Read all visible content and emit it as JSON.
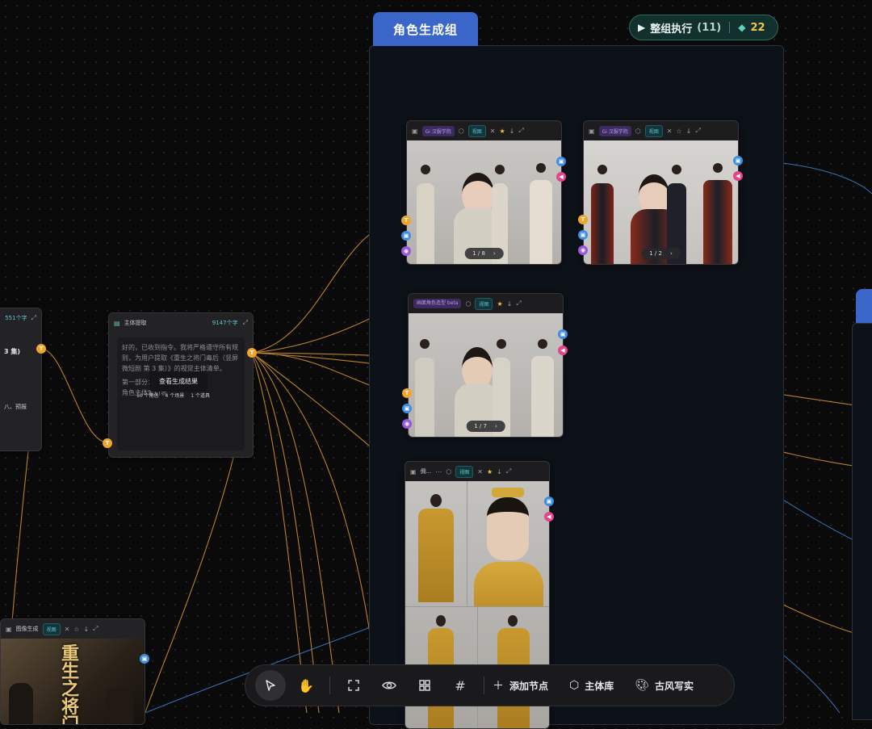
{
  "group": {
    "title": "角色生成组"
  },
  "exec": {
    "label": "整组执行",
    "count": "(11)",
    "credits": "22"
  },
  "nodes": {
    "img1": {
      "tag": "Gi 汉服学院",
      "badge": "视图",
      "pager": "1 / 8"
    },
    "img2": {
      "tag": "Gi 汉服学院",
      "badge": "视图",
      "pager": "1 / 2"
    },
    "img3": {
      "tag": "画面角色造型 beta",
      "badge": "视图",
      "pager": "1 / 7"
    },
    "img4": {
      "tag": "佣...",
      "badge": "视图"
    },
    "text": {
      "title": "主体提取",
      "count": "9147个字",
      "content": "好的，已收到指令。我将严格遵守所有规则，为用户提取《重生之将门毒后（竖屏微短剧 第 3 集）》的视觉主体清单。",
      "content2": "第一部分：角色主体全定义",
      "content3": "角色主体索引表",
      "overlay": "查看生成结果",
      "stat1": "10 个角色",
      "stat2": "4 个场景",
      "stat3": "1 个道具"
    },
    "left": {
      "count": "551个字",
      "line1": "3 集)",
      "line2": "八、预报"
    },
    "poster": {
      "title": "图像生成",
      "badge": "视图",
      "art_text": "重生之将门毒"
    }
  },
  "toolbar": {
    "add": "添加节点",
    "library": "主体库",
    "style": "古风写实"
  },
  "colors": {
    "accent": "#3a66c9",
    "orange_wire": "#e7a23a",
    "blue_wire": "#3f8de0"
  }
}
